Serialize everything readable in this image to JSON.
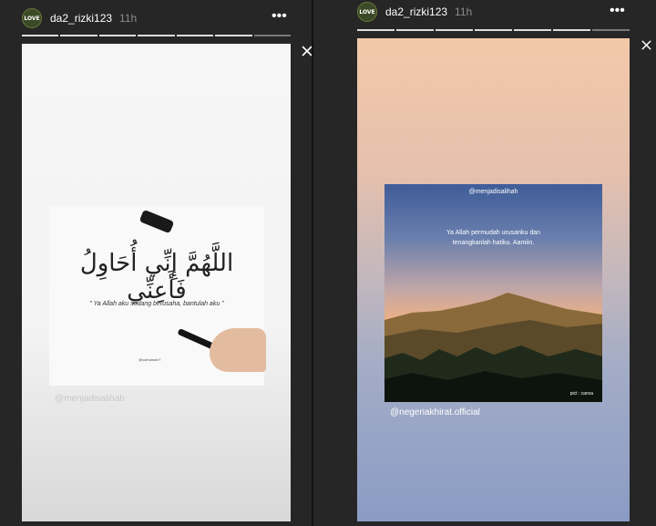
{
  "left_story": {
    "username": "da2_rizki123",
    "time": "11h",
    "avatar_text": "LOVE",
    "more_icon": "more-dots-icon",
    "arabic_text": "اللَّهُمَّ إِنِّي أُحَاوِلُ فَأَعِنِّي",
    "quote": "\" Ya Allah aku sedang berusaha, bantulah aku \"",
    "handle_small": "@sufhaisam7",
    "watermark": "@menjadisalihah"
  },
  "right_story": {
    "username": "da2_rizki123",
    "time": "11h",
    "avatar_text": "LOVE",
    "more_icon": "more-dots-icon",
    "close_icon": "close-icon",
    "card_handle": "@menjadisalihah",
    "quote_line1": "Ya Allah permudah urusanku dan",
    "quote_line2": "tenangkanlah hatiku. Aamiin.",
    "pict_credit": "pict : canva",
    "watermark": "@negeriakhirat.official"
  },
  "colors": {
    "background": "#262626",
    "divider": "#121212",
    "progress_active": "#dcdcdc",
    "progress_pending": "#7a7a7a"
  }
}
